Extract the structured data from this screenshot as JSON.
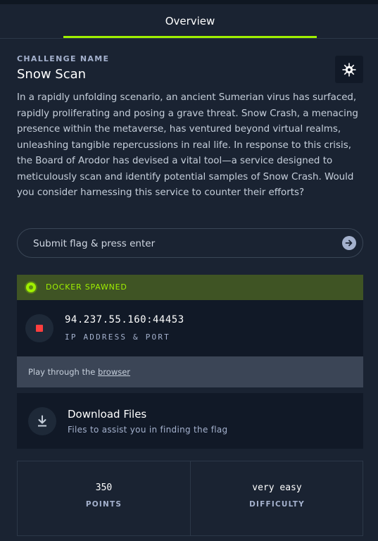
{
  "tabs": {
    "overview": "Overview"
  },
  "challenge": {
    "eyebrow": "CHALLENGE NAME",
    "name": "Snow Scan",
    "category_icon": "snowflake-bug-icon",
    "description": "In a rapidly unfolding scenario, an ancient Sumerian virus has surfaced, rapidly proliferating and posing a grave threat. Snow Crash, a menacing presence within the metaverse, has ventured beyond virtual realms, unleashing tangible repercussions in real life. In response to this crisis, the Board of Arodor has devised a vital tool—a service designed to meticulously scan and identify potential samples of Snow Crash. Would you consider harnessing this service to counter their efforts?"
  },
  "flag": {
    "placeholder": "Submit flag & press enter",
    "value": "",
    "submit_icon": "arrow-right-circle-icon"
  },
  "docker": {
    "status": "DOCKER SPAWNED",
    "status_color": "#9fef00",
    "ip_port": "94.237.55.160:44453",
    "ip_label": "IP ADDRESS & PORT",
    "stop_icon": "stop-icon",
    "browser_prefix": "Play through the ",
    "browser_link": "browser"
  },
  "download": {
    "title": "Download Files",
    "subtitle": "Files to assist you in finding the flag",
    "icon": "download-icon"
  },
  "stats": {
    "points_value": "350",
    "points_label": "POINTS",
    "difficulty_value": "very easy",
    "difficulty_label": "DIFFICULTY"
  },
  "colors": {
    "accent": "#9fef00",
    "background": "#1a2332",
    "panel": "#111927",
    "stop": "#ff3e3e"
  }
}
